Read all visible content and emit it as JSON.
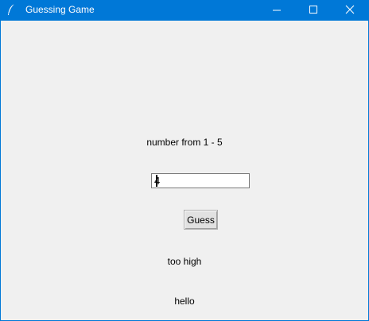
{
  "window": {
    "title": "Guessing Game",
    "app_icon": "tk-feather-icon",
    "controls": {
      "minimize": "minimize-icon",
      "maximize": "maximize-icon",
      "close": "close-icon"
    },
    "title_bar_color": "#0078d7",
    "background_color": "#f0f0f0"
  },
  "main": {
    "prompt_label": "number from 1 - 5",
    "guess_input": {
      "value": "4"
    },
    "guess_button_label": "Guess",
    "result_label": "too high",
    "message_label": "hello"
  }
}
